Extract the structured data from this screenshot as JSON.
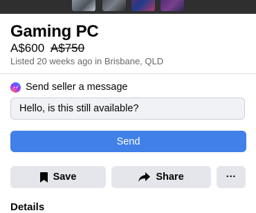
{
  "listing": {
    "title": "Gaming PC",
    "price": "A$600",
    "original_price": "A$750",
    "listed_info": "Listed 20 weeks ago in Brisbane, QLD"
  },
  "message": {
    "header": "Send seller a message",
    "input_value": "Hello, is this still available?",
    "send_label": "Send"
  },
  "actions": {
    "save_label": "Save",
    "share_label": "Share",
    "more_label": "···"
  },
  "sections": {
    "details_heading": "Details"
  },
  "colors": {
    "primary": "#4080e8",
    "button_gray": "#e4e6eb",
    "input_bg": "#f0f2f5",
    "muted_text": "#65676b"
  },
  "icons": {
    "messenger": "messenger-icon",
    "save": "bookmark-icon",
    "share": "share-arrow-icon"
  }
}
